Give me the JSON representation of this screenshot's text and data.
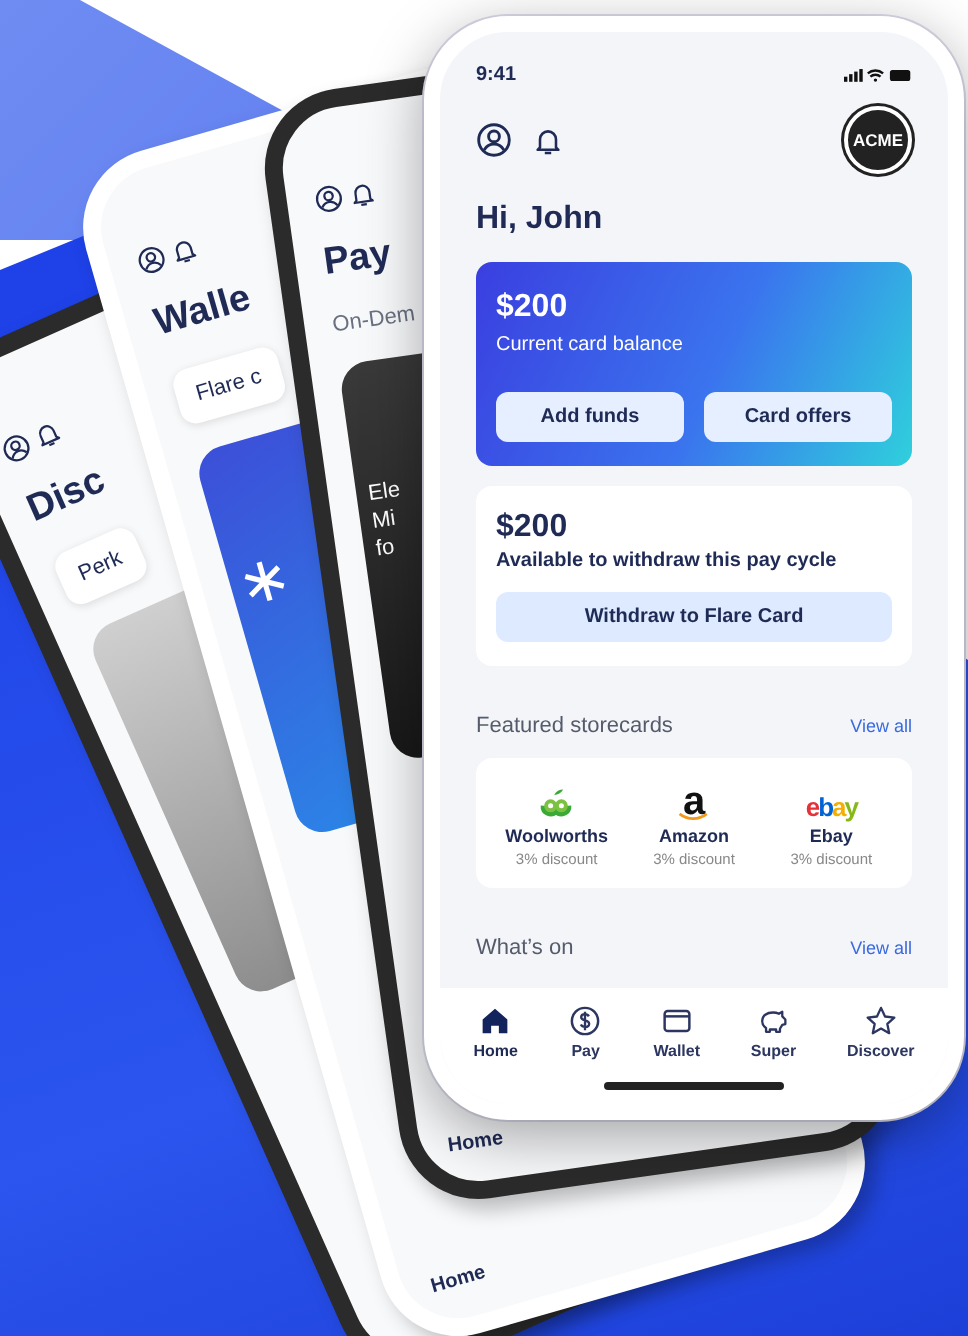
{
  "back_phones": [
    {
      "kind": "discover",
      "title": "Disc",
      "chip": "Perk"
    },
    {
      "kind": "wallet",
      "title": "Walle",
      "chip": "Flare c",
      "nav_label": "Home"
    },
    {
      "kind": "pay",
      "title": "Pay",
      "chip": "On-Dem",
      "card_lines": [
        "Ele",
        "Mi",
        "fo"
      ],
      "nav_label": "Home"
    }
  ],
  "phone": {
    "time": "9:41",
    "logo_text": "ACME",
    "greeting": "Hi, John",
    "balance_card": {
      "amount": "$200",
      "label": "Current card balance",
      "buttons": [
        "Add funds",
        "Card offers"
      ]
    },
    "withdraw_card": {
      "amount": "$200",
      "label": "Available to withdraw this pay cycle",
      "button": "Withdraw to Flare Card"
    },
    "featured": {
      "title": "Featured storecards",
      "link": "View all",
      "stores": [
        {
          "kind": "woolworths",
          "name": "Woolworths",
          "discount": "3% discount"
        },
        {
          "kind": "amazon",
          "logo_text": "a",
          "name": "Amazon",
          "discount": "3% discount"
        },
        {
          "kind": "ebay",
          "logo_text": "ebay",
          "name": "Ebay",
          "discount": "3% discount"
        }
      ]
    },
    "whats_on": {
      "title": "What’s on",
      "link": "View all"
    },
    "nav": [
      {
        "label": "Home",
        "selected": true
      },
      {
        "label": "Pay",
        "selected": false
      },
      {
        "label": "Wallet",
        "selected": false
      },
      {
        "label": "Super",
        "selected": false
      },
      {
        "label": "Discover",
        "selected": false
      }
    ]
  }
}
